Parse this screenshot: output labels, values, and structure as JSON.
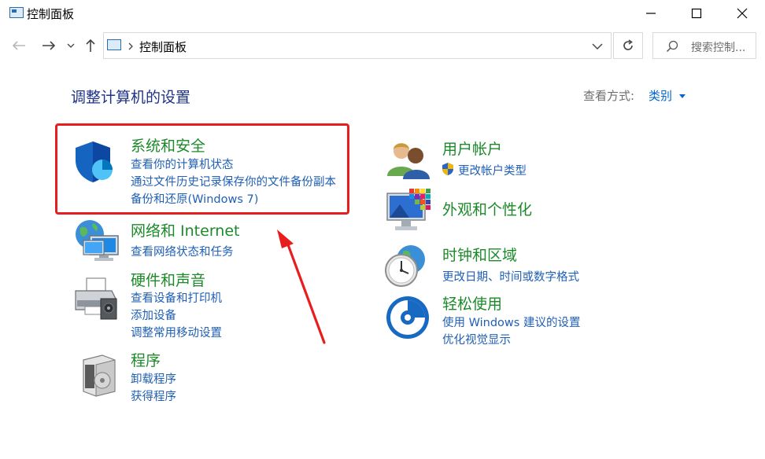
{
  "window": {
    "title": "控制面板"
  },
  "address": {
    "path": "控制面板"
  },
  "search": {
    "placeholder": "搜索控制..."
  },
  "page": {
    "heading": "调整计算机的设置",
    "view_by_label": "查看方式:",
    "view_by_value": "类别"
  },
  "categories_left": [
    {
      "title": "系统和安全",
      "links": [
        "查看你的计算机状态",
        "通过文件历史记录保存你的文件备份副本",
        "备份和还原(Windows 7)"
      ]
    },
    {
      "title": "网络和 Internet",
      "links": [
        "查看网络状态和任务"
      ]
    },
    {
      "title": "硬件和声音",
      "links": [
        "查看设备和打印机",
        "添加设备",
        "调整常用移动设置"
      ]
    },
    {
      "title": "程序",
      "links": [
        "卸载程序",
        "获得程序"
      ]
    }
  ],
  "categories_right": [
    {
      "title": "用户帐户",
      "links": [
        "更改帐户类型"
      ]
    },
    {
      "title": "外观和个性化",
      "links": []
    },
    {
      "title": "时钟和区域",
      "links": [
        "更改日期、时间或数字格式"
      ]
    },
    {
      "title": "轻松使用",
      "links": [
        "使用 Windows 建议的设置",
        "优化视觉显示"
      ]
    }
  ],
  "colors": {
    "link": "#1f5fb5",
    "category_title": "#1d8a2a",
    "heading": "#1e3287",
    "annotation": "#e81d1d"
  }
}
